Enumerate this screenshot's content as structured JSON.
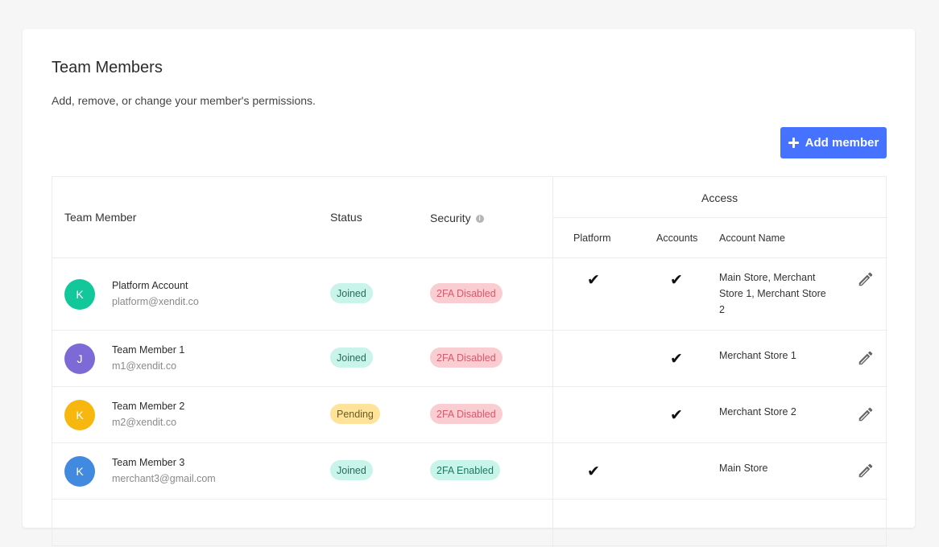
{
  "page": {
    "title": "Team Members",
    "subtitle": "Add, remove, or change your member's permissions.",
    "add_button_label": "Add member"
  },
  "colors": {
    "accent": "#4573ff",
    "joined_bg": "#c8f4ea",
    "pending_bg": "#ffe39a",
    "disabled_bg": "#f9cdd1"
  },
  "table": {
    "headers": {
      "member": "Team Member",
      "status": "Status",
      "security": "Security",
      "access": "Access",
      "platform": "Platform",
      "accounts": "Accounts",
      "account_name": "Account Name"
    },
    "check_glyph": "✔",
    "rows": [
      {
        "initial": "K",
        "avatar_color": "#12c79a",
        "name": "Platform Account",
        "email": "platform@xendit.co",
        "status": "Joined",
        "security": "2FA Disabled",
        "platform": true,
        "accounts": true,
        "account_name": "Main Store, Merchant Store 1, Merchant Store 2"
      },
      {
        "initial": "J",
        "avatar_color": "#7e6ad6",
        "name": "Team Member 1",
        "email": "m1@xendit.co",
        "status": "Joined",
        "security": "2FA Disabled",
        "platform": false,
        "accounts": true,
        "account_name": "Merchant Store 1"
      },
      {
        "initial": "K",
        "avatar_color": "#f7b70f",
        "name": "Team Member 2",
        "email": "m2@xendit.co",
        "status": "Pending",
        "security": "2FA Disabled",
        "platform": false,
        "accounts": true,
        "account_name": "Merchant Store 2"
      },
      {
        "initial": "K",
        "avatar_color": "#4289e0",
        "name": "Team Member 3",
        "email": "merchant3@gmail.com",
        "status": "Joined",
        "security": "2FA Enabled",
        "platform": true,
        "accounts": false,
        "account_name": "Main Store"
      }
    ]
  }
}
